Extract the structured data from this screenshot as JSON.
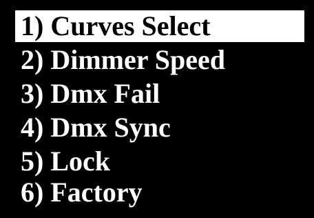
{
  "menu": {
    "items": [
      {
        "label": "1) Curves Select",
        "selected": true
      },
      {
        "label": "2) Dimmer Speed",
        "selected": false
      },
      {
        "label": "3) Dmx Fail",
        "selected": false
      },
      {
        "label": "4) Dmx Sync",
        "selected": false
      },
      {
        "label": "5) Lock",
        "selected": false
      },
      {
        "label": "6) Factory",
        "selected": false
      }
    ]
  },
  "colors": {
    "background": "#000000",
    "text": "#ffffff",
    "highlight_background": "#ffffff",
    "highlight_text": "#000000"
  }
}
